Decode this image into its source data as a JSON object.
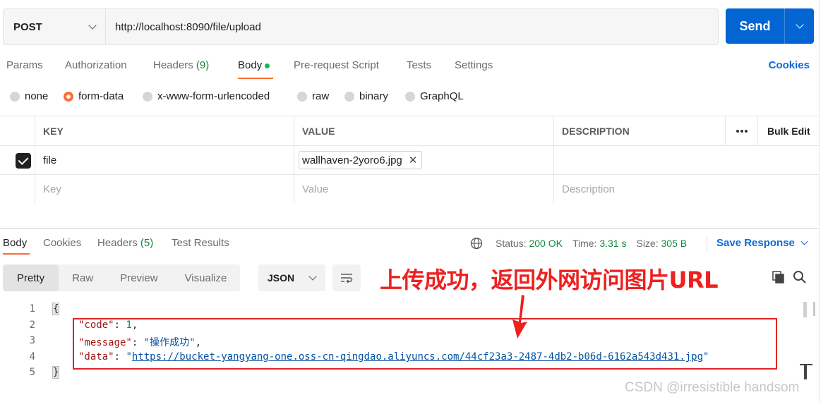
{
  "request": {
    "method": "POST",
    "url": "http://localhost:8090/file/upload",
    "send_label": "Send"
  },
  "request_tabs": {
    "params": "Params",
    "authorization": "Authorization",
    "headers": "Headers",
    "headers_count": "(9)",
    "body": "Body",
    "pre_request": "Pre-request Script",
    "tests": "Tests",
    "settings": "Settings",
    "cookies": "Cookies"
  },
  "body_types": {
    "none": "none",
    "form_data": "form-data",
    "urlencoded": "x-www-form-urlencoded",
    "raw": "raw",
    "binary": "binary",
    "graphql": "GraphQL"
  },
  "params_table": {
    "col_key": "KEY",
    "col_value": "VALUE",
    "col_description": "DESCRIPTION",
    "bulk_edit": "Bulk Edit",
    "row1_key": "file",
    "row1_value": "wallhaven-2yoro6.jpg",
    "placeholder_key": "Key",
    "placeholder_value": "Value",
    "placeholder_description": "Description"
  },
  "response_tabs": {
    "body": "Body",
    "cookies": "Cookies",
    "headers": "Headers",
    "headers_count": "(5)",
    "test_results": "Test Results",
    "status_label": "Status:",
    "status_value": "200 OK",
    "time_label": "Time:",
    "time_value": "3.31 s",
    "size_label": "Size:",
    "size_value": "305 B",
    "save_response": "Save Response"
  },
  "format_bar": {
    "pretty": "Pretty",
    "raw": "Raw",
    "preview": "Preview",
    "visualize": "Visualize",
    "language": "JSON"
  },
  "annotation": "上传成功，返回外网访问图片URL",
  "code": {
    "line_numbers": [
      "1",
      "2",
      "3",
      "4",
      "5"
    ],
    "open_brace": "{",
    "close_brace": "}",
    "key_code": "\"code\"",
    "val_code": "1",
    "key_message": "\"message\"",
    "val_message": "\"操作成功\"",
    "key_data": "\"data\"",
    "val_data_url": "https://bucket-yangyang-one.oss-cn-qingdao.aliyuncs.com/44cf23a3-2487-4db2-b06d-6162a543d431.jpg"
  },
  "watermark": "CSDN @irresistible handsom",
  "colors": {
    "accent_orange": "#ff6c37",
    "send_blue": "#0265d2",
    "link_blue": "#0b6ad8",
    "status_green": "#0f8a3c",
    "annotation_red": "#ee2020"
  }
}
